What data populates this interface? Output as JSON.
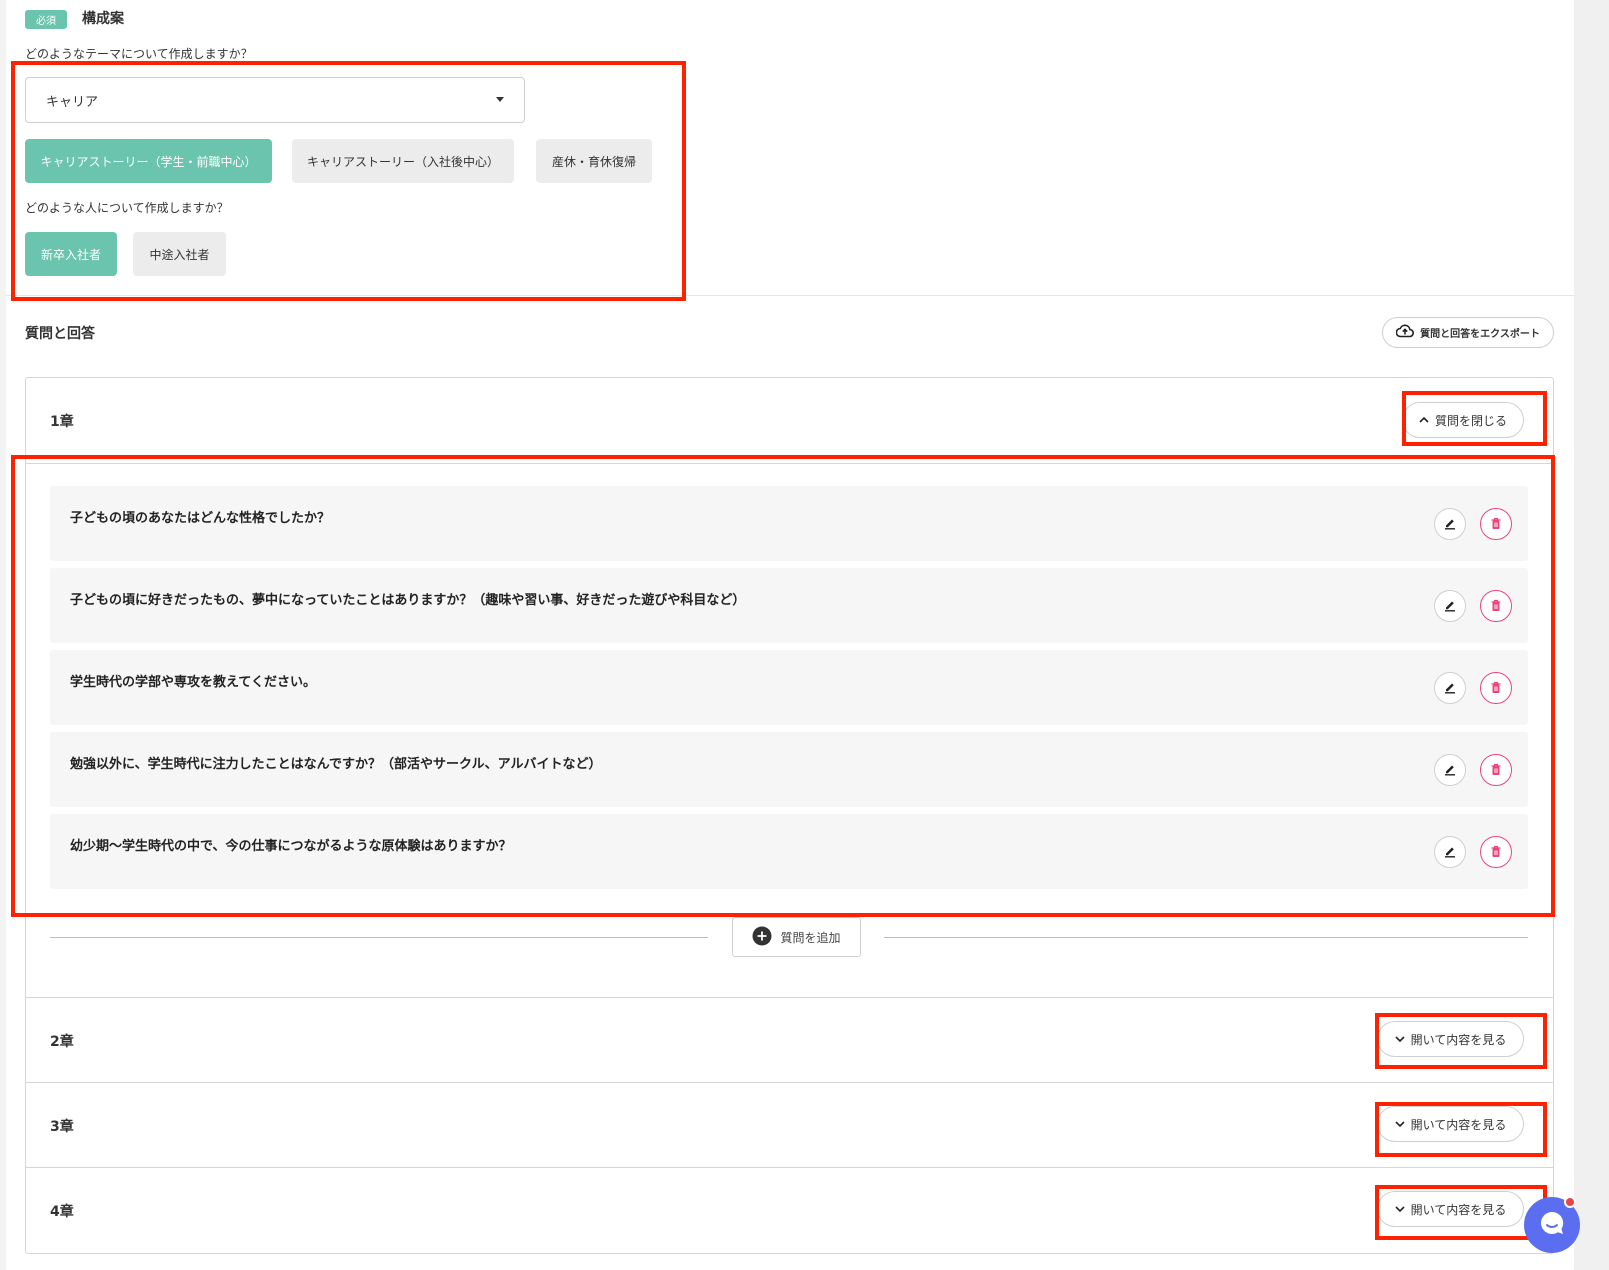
{
  "composition": {
    "required_badge": "必須",
    "title": "構成案",
    "theme_question": "どのようなテーマについて作成しますか？",
    "theme_select_value": "キャリア",
    "theme_options": [
      "キャリアストーリー（学生・前職中心）",
      "キャリアストーリー（入社後中心）",
      "産休・育休復帰"
    ],
    "person_question": "どのような人について作成しますか？",
    "person_options": [
      "新卒入社者",
      "中途入社者"
    ]
  },
  "qa": {
    "title": "質問と回答",
    "export_label": "質問と回答をエクスポート",
    "chapters": [
      {
        "title": "1章",
        "toggle_label": "質問を閉じる",
        "questions": [
          "子どもの頃のあなたはどんな性格でしたか？",
          "子どもの頃に好きだったもの、夢中になっていたことはありますか？（趣味や習い事、好きだった遊びや科目など）",
          "学生時代の学部や専攻を教えてください。",
          "勉強以外に、学生時代に注力したことはなんですか？（部活やサークル、アルバイトなど）",
          "幼少期〜学生時代の中で、今の仕事につながるような原体験はありますか？"
        ],
        "add_label": "質問を追加"
      },
      {
        "title": "2章",
        "toggle_label": "開いて内容を見る"
      },
      {
        "title": "3章",
        "toggle_label": "開いて内容を見る"
      },
      {
        "title": "4章",
        "toggle_label": "開いて内容を見る"
      }
    ]
  },
  "colors": {
    "accent": "#6bc4ad",
    "danger": "#e8467a",
    "highlight": "#ff2200",
    "chat": "#5c6ef0"
  }
}
